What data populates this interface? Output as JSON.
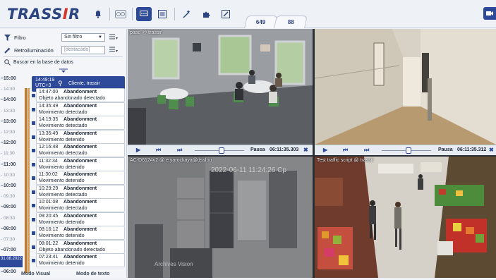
{
  "app": {
    "logo_main": "TRASS",
    "logo_accent": "I",
    "logo_tail": "R"
  },
  "toolbar": {
    "buttons": [
      {
        "icon": "bell-icon"
      },
      {
        "icon": "record-icon"
      },
      {
        "icon": "video-chat-icon",
        "active": true
      },
      {
        "icon": "layout-icon"
      },
      {
        "icon": "wand-icon"
      },
      {
        "icon": "puzzle-icon"
      },
      {
        "icon": "edit-icon"
      }
    ],
    "tabs": [
      {
        "label": "649"
      },
      {
        "label": "88"
      }
    ]
  },
  "filters": {
    "filter_label": "Filtro",
    "filter_value": "Sin filtro",
    "backlight_label": "Retroiluminación",
    "backlight_value": "[destacado]",
    "search_label": "Buscar en la base de datos"
  },
  "timeline": {
    "ticks": [
      "15:00",
      "14:30",
      "14:00",
      "13:30",
      "13:00",
      "12:30",
      "12:00",
      "11:30",
      "11:00",
      "10:30",
      "10:00",
      "09:30",
      "09:00",
      "08:30",
      "08:00",
      "07:30",
      "07:00",
      "06:30",
      "06:00"
    ],
    "date": "31.08.2022"
  },
  "event_header": {
    "time": "14:49:19",
    "tz": "UTC+3",
    "client": "Cliente, trassir"
  },
  "events": [
    {
      "time": "14:47:00",
      "kind": "Abandonment",
      "desc": "Objeto abandonado detectado"
    },
    {
      "time": "14:35:49",
      "kind": "Abandonment",
      "desc": "Movimiento  detectado"
    },
    {
      "time": "14:19:35",
      "kind": "Abandonment",
      "desc": "Movimiento  detectado"
    },
    {
      "time": "13:35:49",
      "kind": "Abandonment",
      "desc": "Movimiento detenido"
    },
    {
      "time": "12:16:48",
      "kind": "Abandonment",
      "desc": "Movimiento  detectado"
    },
    {
      "time": "11:32:34",
      "kind": "Abandonment",
      "desc": "Movimiento  detenido"
    },
    {
      "time": "11:30:02",
      "kind": "Abandonment",
      "desc": "Movimiento detenido"
    },
    {
      "time": "10:29:29",
      "kind": "Abandonment",
      "desc": "Movimiento  detectado"
    },
    {
      "time": "10:01:08",
      "kind": "Abandonment",
      "desc": "Movimiento  detectado"
    },
    {
      "time": "09:20:45",
      "kind": "Abandonment",
      "desc": "Movimiento  detenido"
    },
    {
      "time": "08:16:12",
      "kind": "Abandonment",
      "desc": "Movimiento detenido"
    },
    {
      "time": "08:01:22",
      "kind": "Abandonment",
      "desc": "Objeto abandonado detectado"
    },
    {
      "time": "07:23:41",
      "kind": "Abandonment",
      "desc": "Movimiento detenido"
    }
  ],
  "bottom_tabs": {
    "visual": "Modo Visual",
    "text": "Modo de texto"
  },
  "cameras": {
    "c1": {
      "label": "pase @ trassir"
    },
    "c2": {
      "label": ""
    },
    "c3": {
      "label": "AC-D6124v2 @ e.yarockaya@dssl.ru",
      "overlay_date": "2022-06-11 11:24:26 Cp",
      "overlay_tag": "Archives Vision"
    },
    "c4": {
      "label": "Test traffic script @ trassir"
    }
  },
  "controls": [
    {
      "pause": "Pausa",
      "timestamp": "06:11:35.303"
    },
    {
      "pause": "Pausa",
      "timestamp": "06:11:35.312"
    }
  ]
}
